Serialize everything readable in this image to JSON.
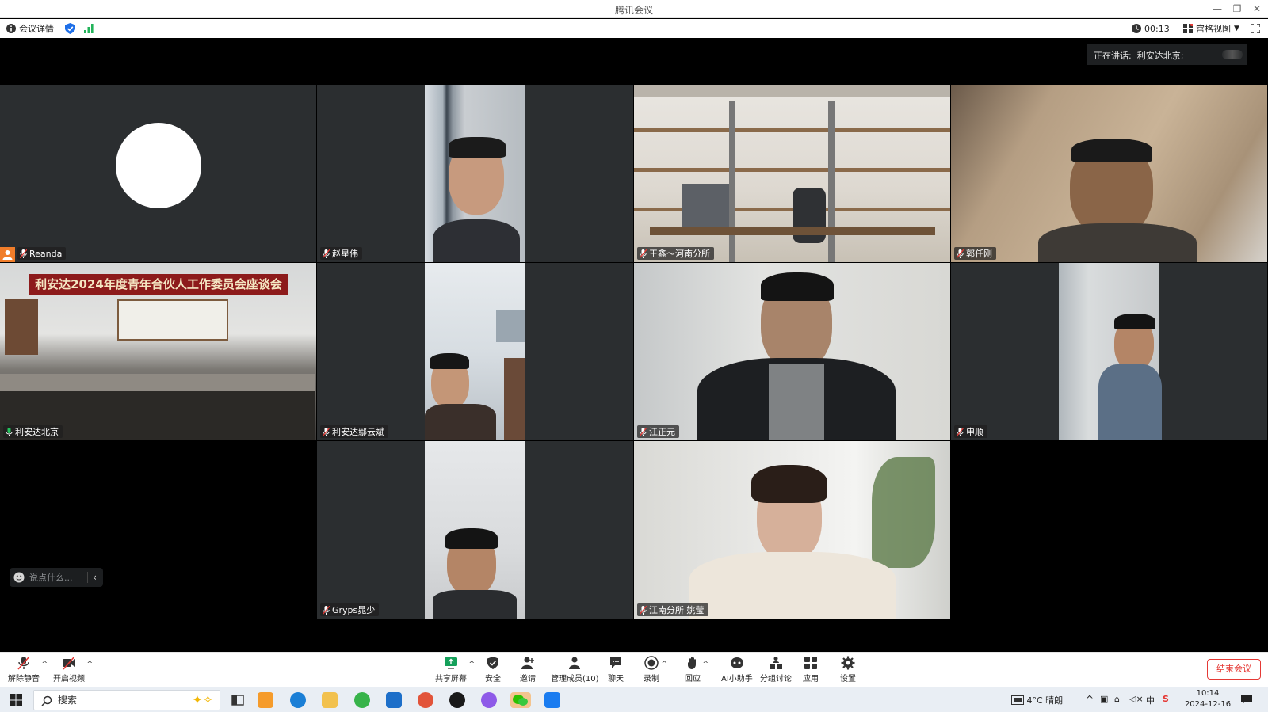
{
  "window": {
    "title": "腾讯会议"
  },
  "infobar": {
    "meeting_details": "会议详情",
    "duration": "00:13",
    "view_mode": "宫格视图"
  },
  "speaking": {
    "label": "正在讲话:",
    "name": "利安达北京;"
  },
  "participants": [
    {
      "name": "Reanda"
    },
    {
      "name": "赵星伟"
    },
    {
      "name": "王鑫～河南分所"
    },
    {
      "name": "郭任刚"
    },
    {
      "name": "利安达北京"
    },
    {
      "name": "利安达鄢云斌"
    },
    {
      "name": "江正元"
    },
    {
      "name": "申顺"
    },
    {
      "name": "Gryps晁少"
    },
    {
      "name": "江南分所 姚莹"
    }
  ],
  "banner": {
    "text": "利安达2024年度青年合伙人工作委员会座谈会"
  },
  "chat": {
    "placeholder": "说点什么..."
  },
  "toolbar": {
    "unmute": "解除静音",
    "start_video": "开启视频",
    "share_screen": "共享屏幕",
    "security": "安全",
    "invite": "邀请",
    "manage_members": "管理成员(10)",
    "chat": "聊天",
    "record": "录制",
    "react": "回应",
    "ai_assistant": "AI小助手",
    "breakout": "分组讨论",
    "apps": "应用",
    "settings": "设置",
    "end_meeting": "结束会议"
  },
  "taskbar": {
    "search_text": "搜索",
    "weather": "4°C 晴朗",
    "time": "10:14",
    "date": "2024-12-16"
  },
  "colors": {
    "accent_green": "#22c35d",
    "end_red": "#e53935",
    "host_orange": "#f07d2a",
    "tile_bg": "#2b2e30"
  }
}
